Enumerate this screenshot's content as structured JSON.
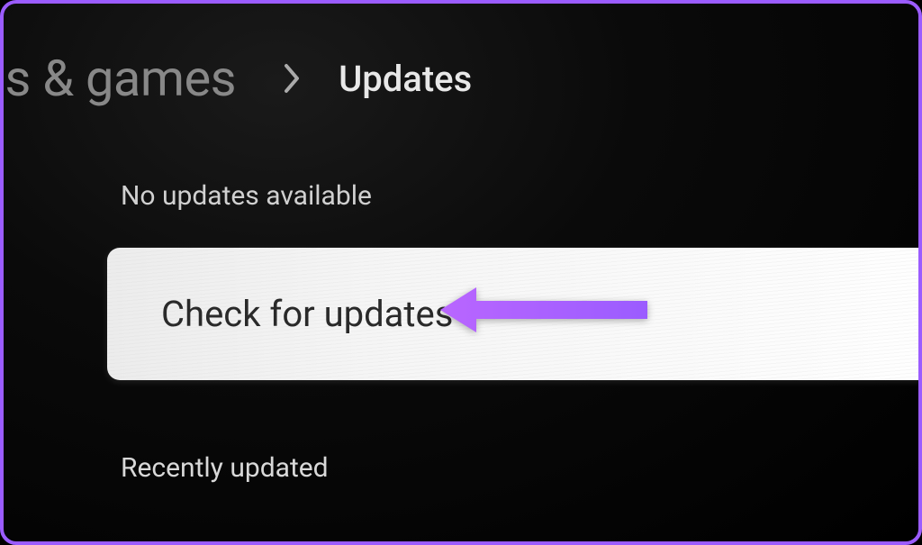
{
  "breadcrumb": {
    "parent": "os & games",
    "current": "Updates"
  },
  "status": {
    "message": "No updates available"
  },
  "actions": {
    "check_updates_label": "Check for updates"
  },
  "sections": {
    "recently_updated_header": "Recently updated"
  },
  "colors": {
    "accent": "#9b5cff",
    "annotation": "#a855f7"
  }
}
